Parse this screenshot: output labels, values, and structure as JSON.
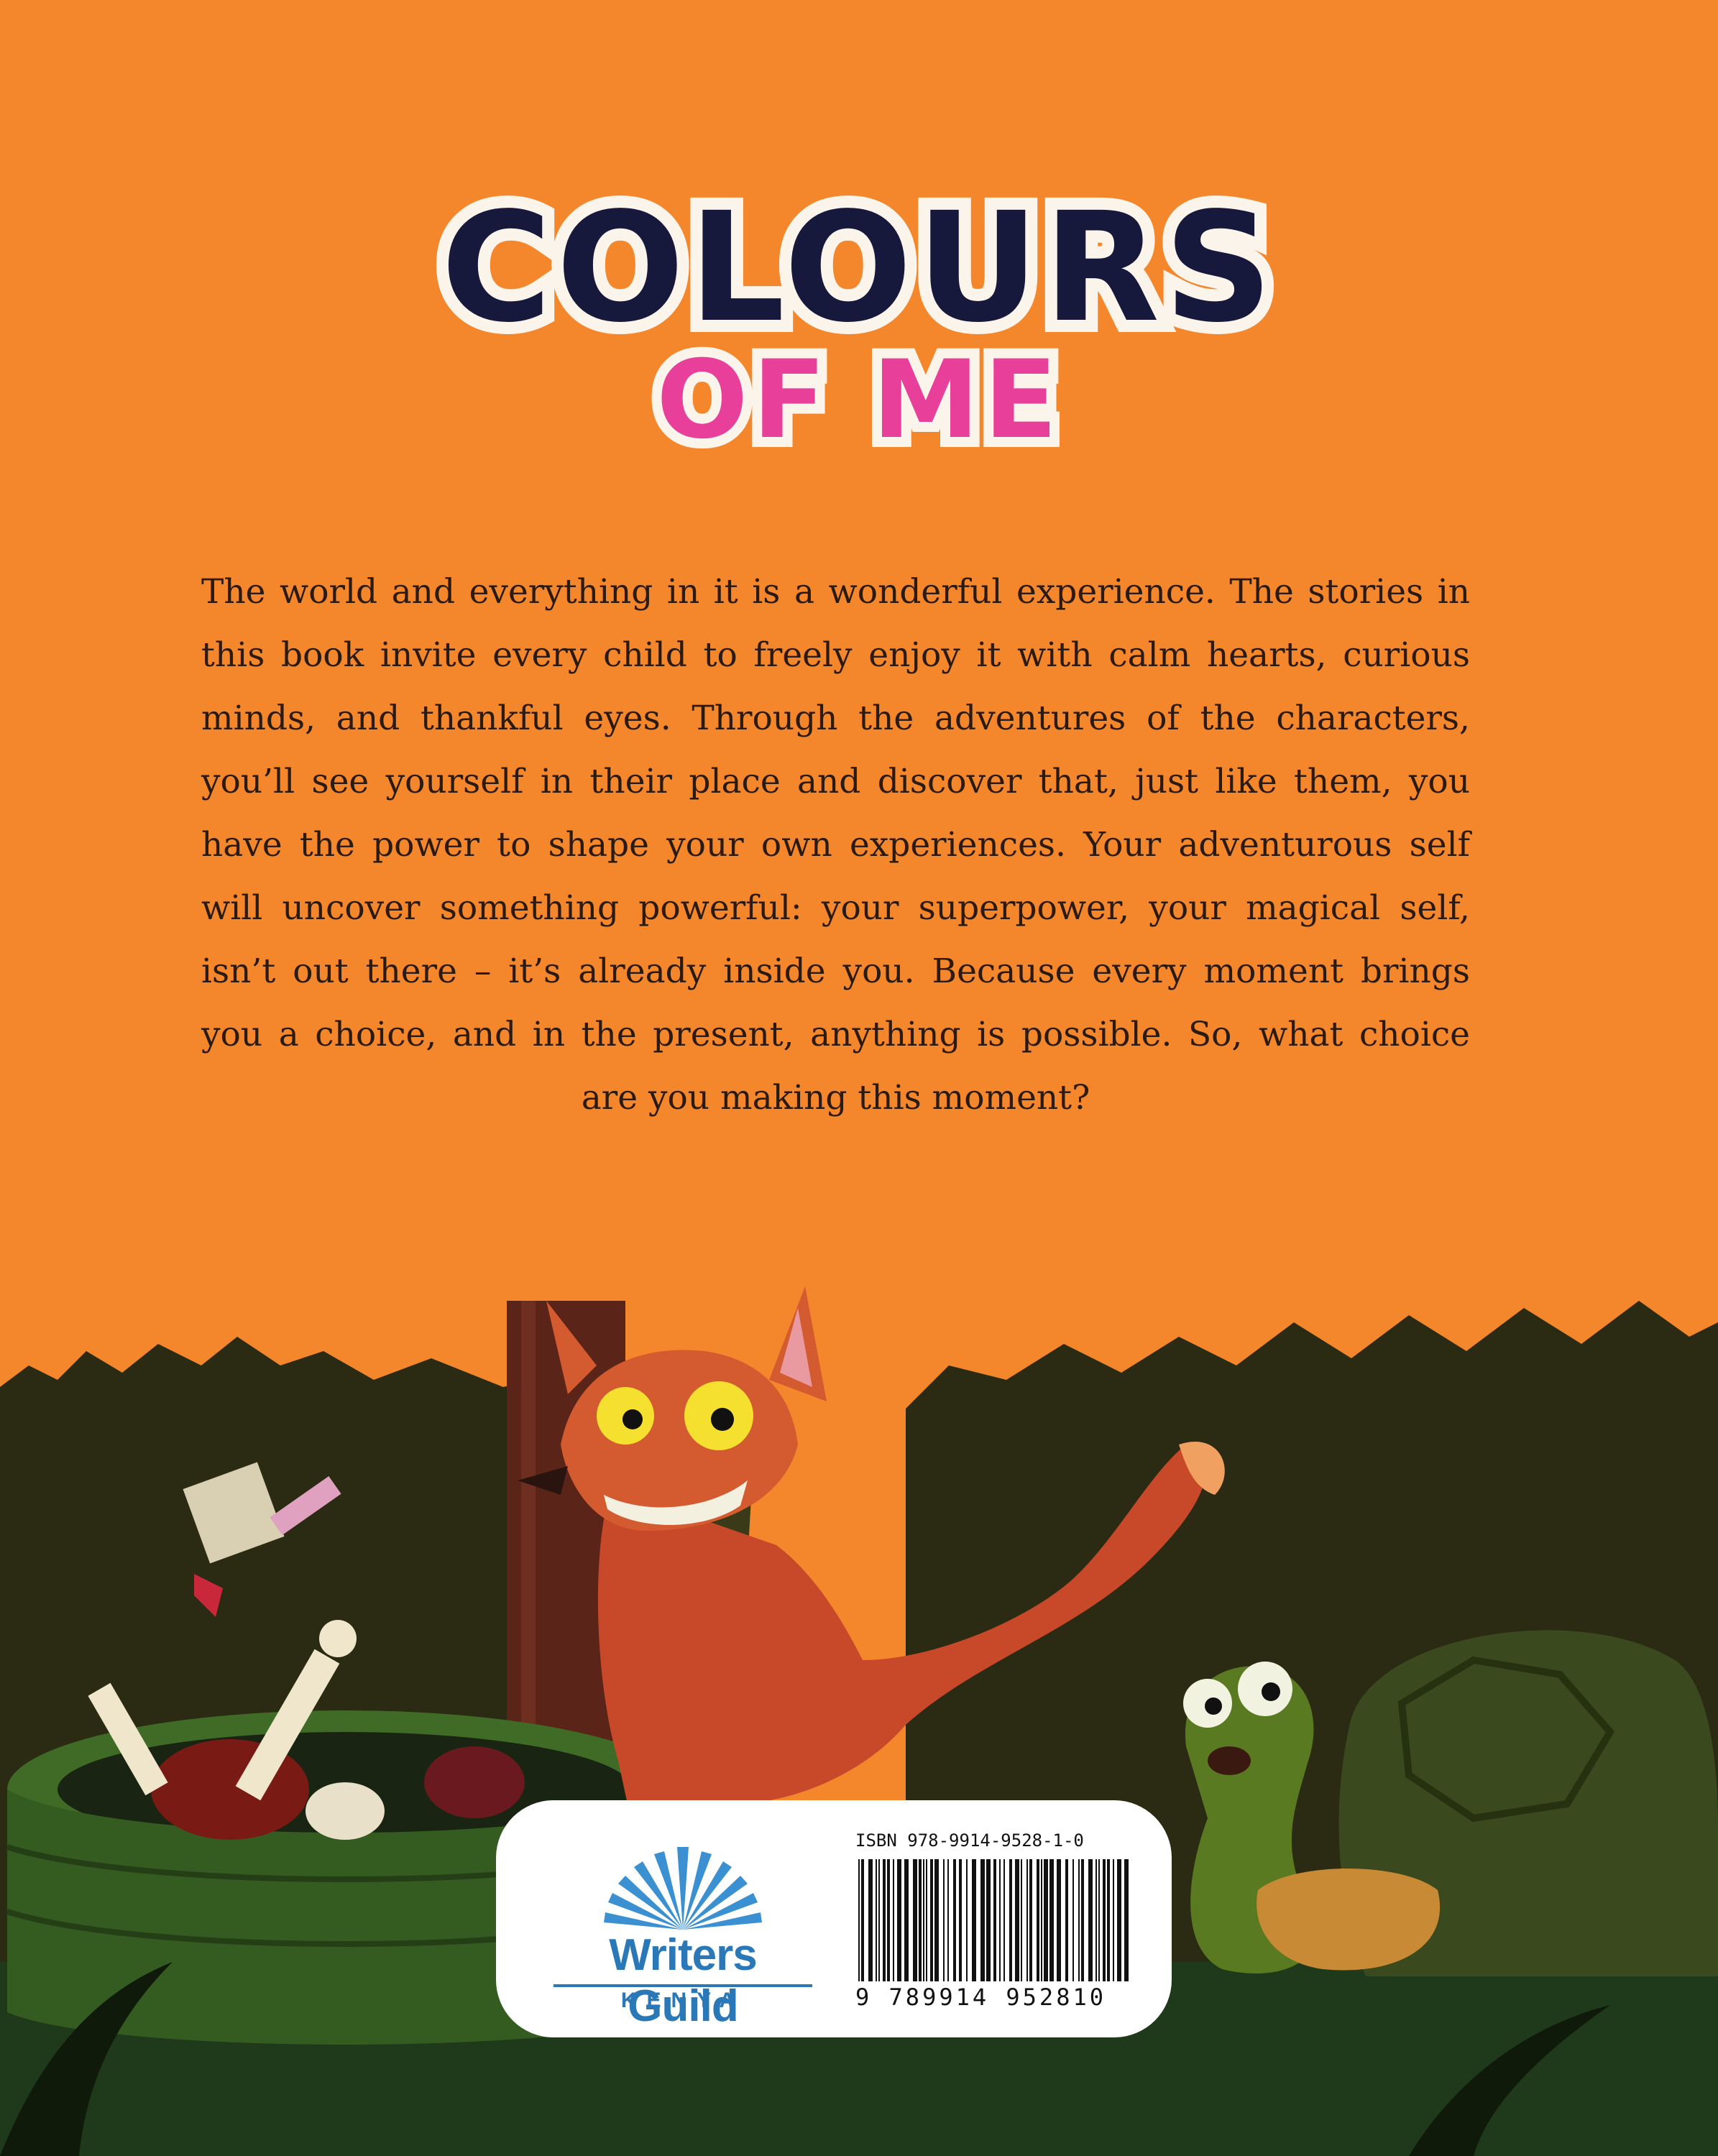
{
  "cover": {
    "title_line1": "COLOURS",
    "title_line2": "OF ME",
    "blurb": "The world and everything in it is a wonderful experience. The stories in this book invite every child to freely enjoy it with calm hearts, curious minds, and thankful eyes. Through the adventures of the characters, you’ll see yourself in their place and discover that, just like them, you have the power to shape your own experiences. Your adventurous self will uncover something powerful: your superpower, your magical self, isn’t out there – it’s already inside you. Because every moment brings you a choice, and in the present, anything is possible. So, what choice are you making this moment?"
  },
  "publisher": {
    "name": "Writers Guild",
    "subname": "KENYA"
  },
  "barcode": {
    "isbn_label": "ISBN 978-9914-9528-1-0",
    "digits": "9 789914 952810"
  },
  "colors": {
    "background": "#f4862c",
    "title_dark": "#16183c",
    "title_pink": "#e8409a",
    "publisher_blue": "#2a78b8"
  }
}
